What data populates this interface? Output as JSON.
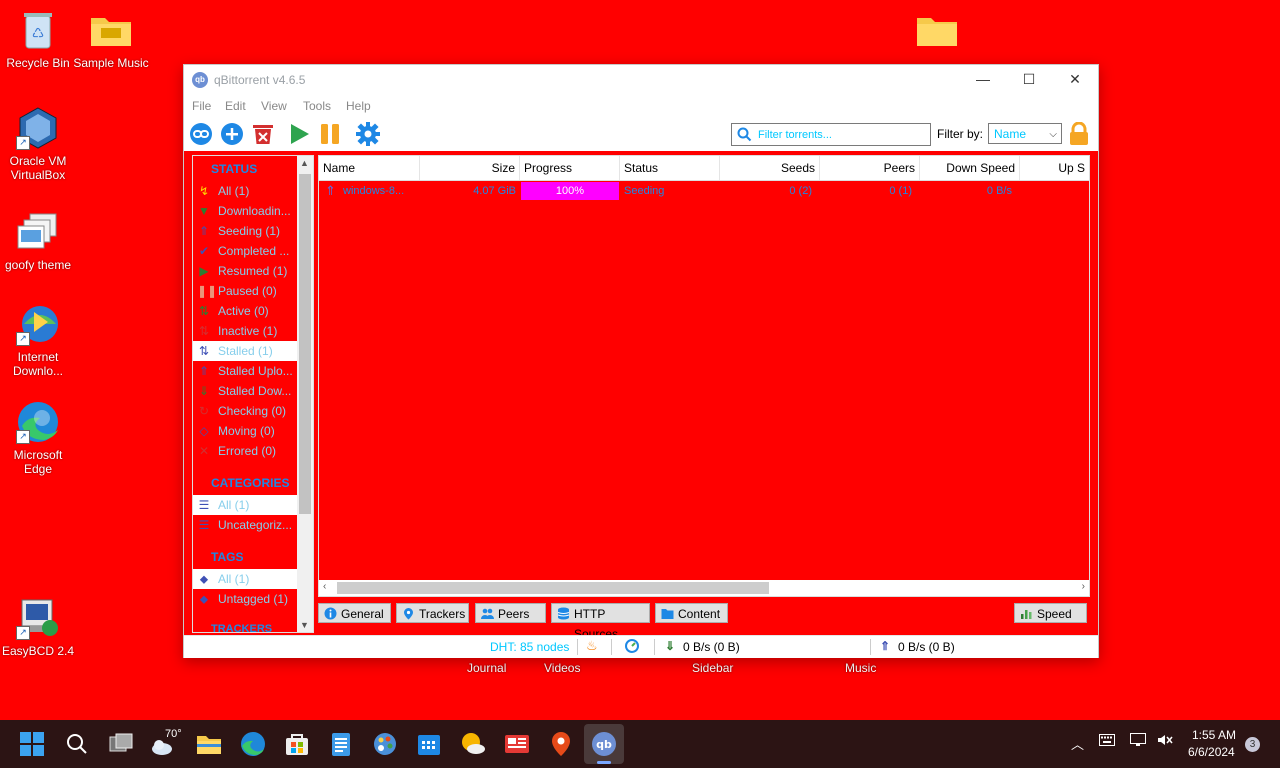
{
  "desktop": {
    "icons": [
      {
        "label": "Recycle Bin"
      },
      {
        "label": "Sample Music"
      },
      {
        "label": "Oracle VM VirtualBox"
      },
      {
        "label": "goofy theme"
      },
      {
        "label": "Internet Downlo..."
      },
      {
        "label": "Microsoft Edge"
      },
      {
        "label": "EasyBCD 2.4"
      }
    ],
    "behind_labels": [
      "Journal",
      "Videos",
      "Sidebar",
      "Music"
    ]
  },
  "window": {
    "title": "qBittorrent v4.6.5",
    "logo_text": "qb",
    "minimize": "—",
    "maximize": "☐",
    "close": "✕"
  },
  "menu": [
    "File",
    "Edit",
    "View",
    "Tools",
    "Help"
  ],
  "toolbar": {
    "search_placeholder": "Filter torrents...",
    "filter_label": "Filter by:",
    "filter_value": "Name"
  },
  "sidebar": {
    "status_header": "STATUS",
    "status_items": [
      {
        "label": "All (1)",
        "icon": "↯",
        "color": "#ffd700"
      },
      {
        "label": "Downloadin...",
        "icon": "▼",
        "color": "#2e7d32"
      },
      {
        "label": "Seeding (1)",
        "icon": "⇑",
        "color": "#3f51b5"
      },
      {
        "label": "Completed ...",
        "icon": "✔",
        "color": "#3f51b5"
      },
      {
        "label": "Resumed (1)",
        "icon": "▶",
        "color": "#2e7d32"
      },
      {
        "label": "Paused (0)",
        "icon": "❚❚",
        "color": "#e9967a"
      },
      {
        "label": "Active (0)",
        "icon": "⇅",
        "color": "#2e7d32"
      },
      {
        "label": "Inactive (1)",
        "icon": "⇅",
        "color": "#d32f2f"
      },
      {
        "label": "Stalled (1)",
        "icon": "⇅",
        "color": "#3f51b5"
      },
      {
        "label": "Stalled Uplo...",
        "icon": "⇑",
        "color": "#3f51b5"
      },
      {
        "label": "Stalled Dow...",
        "icon": "⇓",
        "color": "#2e7d32"
      },
      {
        "label": "Checking (0)",
        "icon": "↻",
        "color": "#d32f2f"
      },
      {
        "label": "Moving (0)",
        "icon": "◇",
        "color": "#3f51b5"
      },
      {
        "label": "Errored (0)",
        "icon": "✕",
        "color": "#d32f2f"
      }
    ],
    "categories_header": "CATEGORIES",
    "category_items": [
      {
        "label": "All (1)"
      },
      {
        "label": "Uncategoriz..."
      }
    ],
    "tags_header": "TAGS",
    "tag_items": [
      {
        "label": "All (1)"
      },
      {
        "label": "Untagged (1)"
      }
    ],
    "trackers_header": "TRACKERS"
  },
  "table": {
    "columns": [
      "Name",
      "Size",
      "Progress",
      "Status",
      "Seeds",
      "Peers",
      "Down Speed",
      "Up S"
    ],
    "rows": [
      {
        "name": "windows-8...",
        "size": "4.07 GiB",
        "progress": "100%",
        "status": "Seeding",
        "seeds": "0 (2)",
        "peers": "0 (1)",
        "down": "0 B/s",
        "up": ""
      }
    ]
  },
  "tabs": [
    "General",
    "Trackers",
    "Peers",
    "HTTP Sources",
    "Content"
  ],
  "speed_button": "Speed",
  "statusbar": {
    "dht": "DHT: 85 nodes",
    "down": "0 B/s (0 B)",
    "up": "0 B/s (0 B)"
  },
  "taskbar": {
    "weather": "70°",
    "time": "1:55 AM",
    "date": "6/6/2024",
    "notifications": "3"
  },
  "colors": {
    "background": "#ff0000",
    "sidebar_text": "#87ceeb",
    "row_text": "#1e88e5",
    "progress": "#ff00ff"
  }
}
